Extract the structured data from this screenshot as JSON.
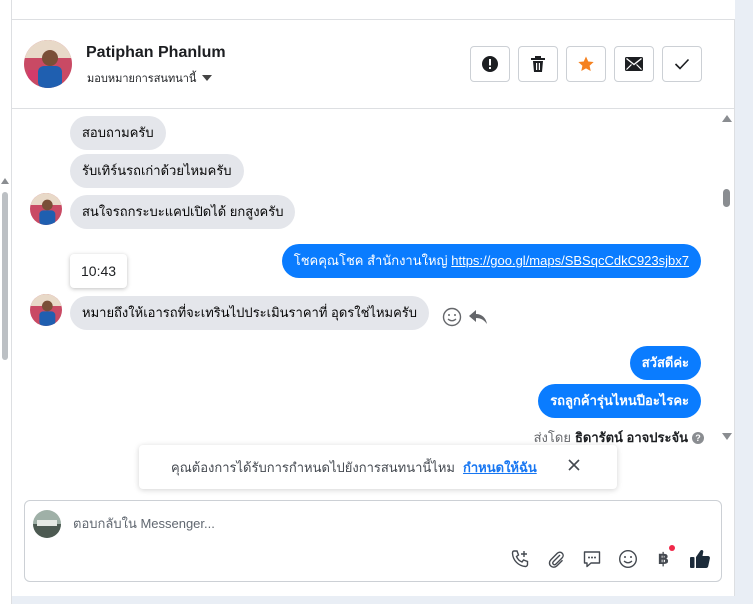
{
  "header": {
    "name": "Patiphan Phanlum",
    "assign_label": "มอบหมายการสนทนานี้",
    "actions": [
      {
        "id": "report",
        "icon": "alert-circle-icon"
      },
      {
        "id": "delete",
        "icon": "trash-icon"
      },
      {
        "id": "star",
        "icon": "star-icon",
        "color": "#f5811f"
      },
      {
        "id": "email",
        "icon": "envelope-icon"
      },
      {
        "id": "done",
        "icon": "check-icon"
      }
    ]
  },
  "messages": {
    "incoming": [
      "สอบถามครับ",
      "รับเทิร์นรถเก่าด้วยไหมครับ",
      "สนใจรถกระบะแคปเปิดได้ ยกสูงครับ"
    ],
    "outgoing_link": {
      "text": "โชคคุณโชค สำนักงานใหญ่",
      "url": "https://goo.gl/maps/SBSqcCdkC923sjbx7"
    },
    "time_chip": "10:43",
    "incoming_2": "หมายถึงให้เอารถที่จะเทรินไปประเมินราคาที่ อุดรใช่ไหมครับ",
    "outgoing": [
      "สวัสดีค่ะ",
      "รถลูกค้ารุ่นไหนปีอะไรคะ"
    ],
    "sent_by_prefix": "ส่งโดย",
    "sent_by_name": "ธิดารัตน์ อาจประจัน"
  },
  "prompt": {
    "text": "คุณต้องการได้รับการกำหนดไปยังการสนทนานี้ไหม",
    "cta": "กำหนดให้ฉัน"
  },
  "composer": {
    "placeholder": "ตอบกลับใน Messenger...",
    "tools": [
      "call-add-icon",
      "paperclip-icon",
      "chat-bubble-icon",
      "smiley-icon",
      "baht-icon",
      "thumbs-up-icon"
    ]
  },
  "colors": {
    "accent": "#0a7cff",
    "incoming_bg": "#e4e6eb",
    "star": "#f5811f",
    "link_cta": "#1877f2"
  }
}
